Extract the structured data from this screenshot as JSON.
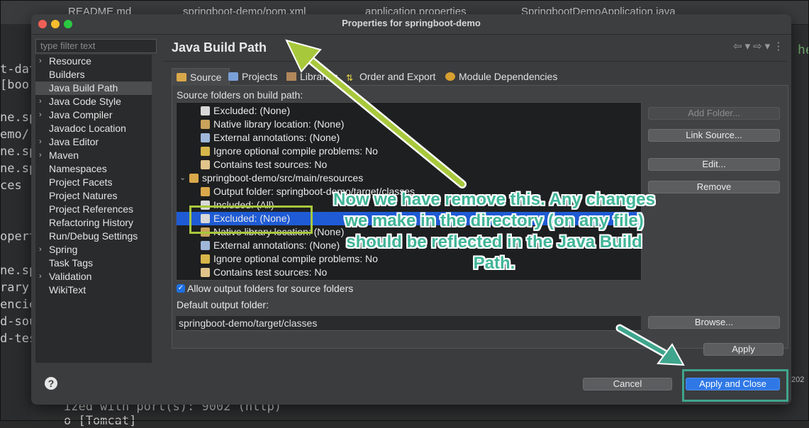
{
  "background": {
    "tabs": [
      "README.md",
      "springboot-demo/pom.xml",
      "application.properties",
      "SpringbootDemoApplication.java"
    ],
    "left_fragments": [
      "t-data",
      "[boo",
      "ne.sp",
      "emo/",
      "ne.sp",
      "ne.sp",
      "ces",
      "opert",
      "ne.sp",
      "rary [",
      "encie",
      "d-sou",
      "d-tes"
    ],
    "console_lines": [
      "ized with port(s): 9002 (http)",
      "o [Tomcat]"
    ],
    "right_fragment": "he",
    "right_number": "202"
  },
  "dialog": {
    "title": "Properties for springboot-demo",
    "filter_placeholder": "type filter text",
    "tree": [
      {
        "label": "Resource",
        "expandable": true
      },
      {
        "label": "Builders",
        "expandable": false
      },
      {
        "label": "Java Build Path",
        "expandable": false,
        "selected": true
      },
      {
        "label": "Java Code Style",
        "expandable": true
      },
      {
        "label": "Java Compiler",
        "expandable": true
      },
      {
        "label": "Javadoc Location",
        "expandable": false
      },
      {
        "label": "Java Editor",
        "expandable": true
      },
      {
        "label": "Maven",
        "expandable": true
      },
      {
        "label": "Namespaces",
        "expandable": false
      },
      {
        "label": "Project Facets",
        "expandable": false
      },
      {
        "label": "Project Natures",
        "expandable": false
      },
      {
        "label": "Project References",
        "expandable": false
      },
      {
        "label": "Refactoring History",
        "expandable": false
      },
      {
        "label": "Run/Debug Settings",
        "expandable": false
      },
      {
        "label": "Spring",
        "expandable": true
      },
      {
        "label": "Task Tags",
        "expandable": false
      },
      {
        "label": "Validation",
        "expandable": true
      },
      {
        "label": "WikiText",
        "expandable": false
      }
    ],
    "page_title": "Java Build Path",
    "tabs": [
      {
        "label": "Source",
        "icon": "source-folder-icon",
        "active": true
      },
      {
        "label": "Projects",
        "icon": "projects-icon"
      },
      {
        "label": "Libraries",
        "icon": "libraries-icon"
      },
      {
        "label": "Order and Export",
        "icon": "order-export-icon"
      },
      {
        "label": "Module Dependencies",
        "icon": "module-icon"
      }
    ],
    "source_label": "Source folders on build path:",
    "source_rows": [
      {
        "text": "Excluded: (None)",
        "icon": "filter-icon",
        "indent": 2
      },
      {
        "text": "Native library location: (None)",
        "icon": "native-library-icon",
        "indent": 2
      },
      {
        "text": "External annotations: (None)",
        "icon": "annotations-icon",
        "indent": 2
      },
      {
        "text": "Ignore optional compile problems: No",
        "icon": "ignore-problems-icon",
        "indent": 2
      },
      {
        "text": "Contains test sources: No",
        "icon": "test-sources-icon",
        "indent": 2
      },
      {
        "text": "springboot-demo/src/main/resources",
        "icon": "package-folder-icon",
        "indent": 1,
        "expanded": true
      },
      {
        "text": "Output folder: springboot-demo/target/classes",
        "icon": "output-folder-icon",
        "indent": 2
      },
      {
        "text": "Included: (All)",
        "icon": "filter-icon",
        "indent": 2
      },
      {
        "text": "Excluded: (None)",
        "icon": "filter-icon",
        "indent": 2,
        "selected": true
      },
      {
        "text": "Native library location: (None)",
        "icon": "native-library-icon",
        "indent": 2
      },
      {
        "text": "External annotations: (None)",
        "icon": "annotations-icon",
        "indent": 2
      },
      {
        "text": "Ignore optional compile problems: No",
        "icon": "ignore-problems-icon",
        "indent": 2
      },
      {
        "text": "Contains test sources: No",
        "icon": "test-sources-icon",
        "indent": 2
      }
    ],
    "buttons": {
      "add_folder": "Add Folder...",
      "link_source": "Link Source...",
      "edit": "Edit...",
      "remove": "Remove",
      "browse": "Browse...",
      "apply": "Apply",
      "cancel": "Cancel",
      "apply_close": "Apply and Close"
    },
    "allow_output_label": "Allow output folders for source folders",
    "allow_output_checked": true,
    "default_output_label": "Default output folder:",
    "default_output_value": "springboot-demo/target/classes"
  },
  "annotation": {
    "text": "Now we have remove this. Any changes we make in the directory (on any file) should be reflected in the Java Build Path.",
    "color": "#41b598",
    "highlight_color": "#a8c83c",
    "arrow_color": "#a8c83c",
    "arrow2_color": "#3fa58d"
  },
  "colors": {
    "selection": "#1f5bd4",
    "primary_button": "#2f78e6"
  }
}
